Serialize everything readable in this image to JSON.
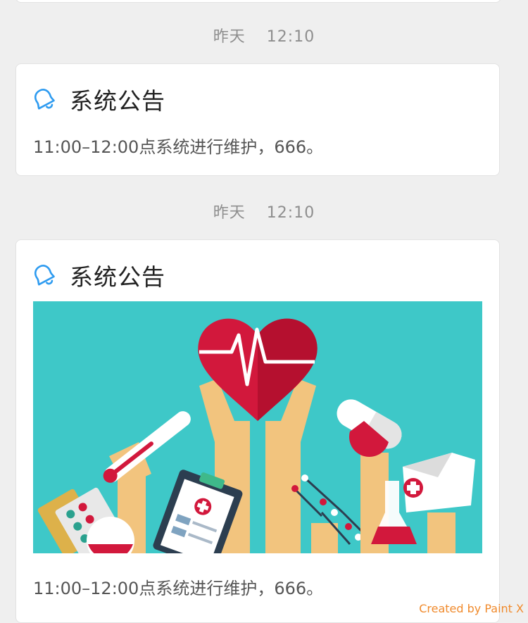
{
  "feed": [
    {
      "timestamp": {
        "day": "昨天",
        "time": "12:10"
      },
      "notice": {
        "icon": "bell-icon",
        "title": "系统公告",
        "body": "11:00–12:00点系统进行维护，666。"
      }
    },
    {
      "timestamp": {
        "day": "昨天",
        "time": "12:10"
      },
      "notice": {
        "icon": "bell-icon",
        "title": "系统公告",
        "image": "medical-health-illustration",
        "body": "11:00–12:00点系统进行维护，666。"
      }
    }
  ],
  "watermark": "Created by Paint X",
  "colors": {
    "background": "#efefef",
    "icon_blue": "#2e9bf0",
    "banner_teal": "#3ec8c8",
    "heart_red": "#d2183c",
    "watermark_orange": "#f08a2c"
  }
}
